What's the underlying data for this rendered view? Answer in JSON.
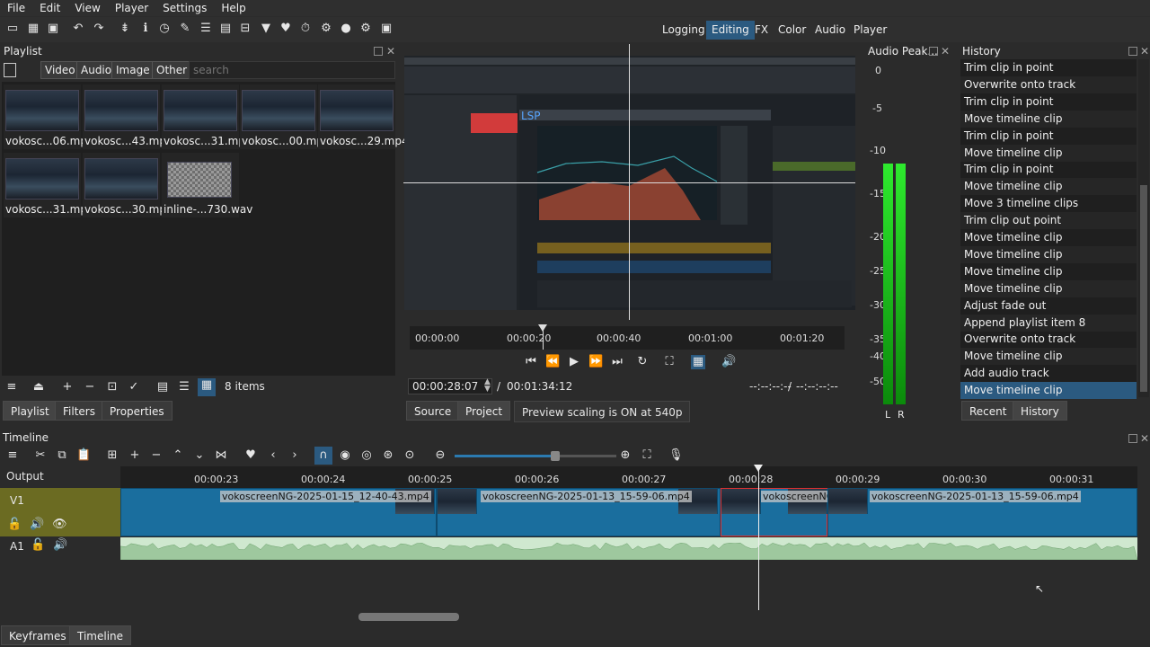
{
  "menu": [
    "File",
    "Edit",
    "View",
    "Player",
    "Settings",
    "Help"
  ],
  "workspaces": [
    {
      "label": "Logging",
      "active": false
    },
    {
      "label": "Editing",
      "active": true
    },
    {
      "label": "FX",
      "active": false
    },
    {
      "label": "Color",
      "active": false
    },
    {
      "label": "Audio",
      "active": false
    },
    {
      "label": "Player",
      "active": false
    }
  ],
  "playlist": {
    "title": "Playlist",
    "filters": [
      "Video",
      "Audio",
      "Image",
      "Other"
    ],
    "search_placeholder": "search",
    "items": [
      {
        "caption": "vokosc...06.mp4",
        "kind": "video"
      },
      {
        "caption": "vokosc...43.mp4",
        "kind": "video"
      },
      {
        "caption": "vokosc...31.mp4",
        "kind": "video"
      },
      {
        "caption": "vokosc...00.mp4",
        "kind": "video"
      },
      {
        "caption": "vokosc...29.mp4",
        "kind": "video"
      },
      {
        "caption": "vokosc...31.mp4",
        "kind": "video"
      },
      {
        "caption": "vokosc...30.mp4",
        "kind": "video"
      },
      {
        "caption": "inline-...730.wav",
        "kind": "audio"
      }
    ],
    "count": "8 items",
    "tabs": [
      "Playlist",
      "Filters",
      "Properties"
    ]
  },
  "player": {
    "ruler_labels": [
      "00:00:00",
      "00:00:20",
      "00:00:40",
      "00:01:00",
      "00:01:20"
    ],
    "position": "00:00:28:07",
    "separator": "/",
    "duration": "00:01:34:12",
    "in_point": "--:--:--:--",
    "out_point": "--:--:--:--",
    "tabs": [
      "Source",
      "Project"
    ],
    "status": "Preview scaling is ON at 540p"
  },
  "audio_peak": {
    "title": "Audio Peak...",
    "scale": [
      "0",
      "-5",
      "-10",
      "-15",
      "-20",
      "-25",
      "-30",
      "-35",
      "-40",
      "-50"
    ],
    "channels": [
      "L",
      "R"
    ],
    "level_l": 0.72,
    "level_r": 0.72
  },
  "history": {
    "title": "History",
    "items": [
      "Trim clip in point",
      "Overwrite onto track",
      "Trim clip in point",
      "Move timeline clip",
      "Trim clip in point",
      "Move timeline clip",
      "Trim clip in point",
      "Move timeline clip",
      "Move 3 timeline clips",
      "Trim clip out point",
      "Move timeline clip",
      "Move timeline clip",
      "Move timeline clip",
      "Move timeline clip",
      "Adjust fade out",
      "Append playlist item 8",
      "Overwrite onto track",
      "Move timeline clip",
      "Add audio track",
      "Move timeline clip"
    ],
    "selected_index": 19,
    "tabs": [
      "Recent",
      "History"
    ]
  },
  "timeline": {
    "title": "Timeline",
    "output_label": "Output",
    "ruler_labels": [
      "00:00:23",
      "00:00:24",
      "00:00:25",
      "00:00:26",
      "00:00:27",
      "00:00:28",
      "00:00:29",
      "00:00:30",
      "00:00:31"
    ],
    "tracks": [
      {
        "name": "V1"
      },
      {
        "name": "A1"
      }
    ],
    "clips": [
      {
        "label": "vokoscreenNG-2025-01-15_12-40-43.mp4"
      },
      {
        "label": "vokoscreenNG-2025-01-13_15-59-06.mp4"
      },
      {
        "label": "vokoscreenNG-"
      },
      {
        "label": "vokoscreenNG-2025-01-13_15-59-06.mp4"
      }
    ],
    "zoom_level": 0.62
  },
  "bottom_tabs": [
    "Keyframes",
    "Timeline"
  ]
}
